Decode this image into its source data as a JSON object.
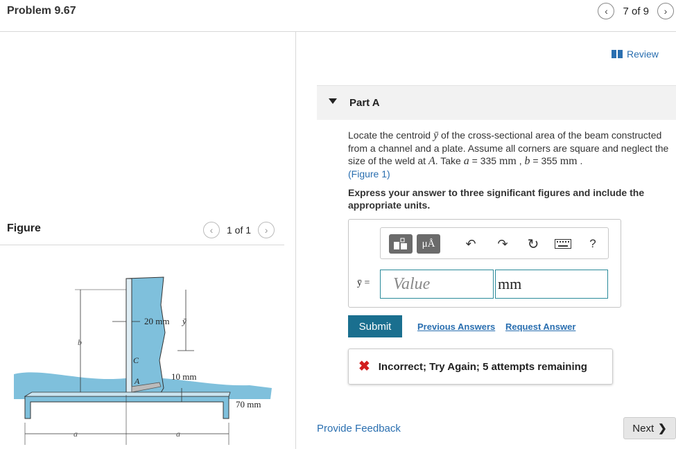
{
  "header": {
    "title": "Problem 9.67",
    "pager": {
      "text": "7 of 9",
      "prev_icon": "chevron-left-icon",
      "next_icon": "chevron-right-icon"
    }
  },
  "figure_panel": {
    "label": "Figure",
    "pager": {
      "text": "1 of 1"
    },
    "figure_labels": {
      "dim_20": "20 mm",
      "ybar": "ȳ",
      "dim_10": "10 mm",
      "dim_70": "70 mm",
      "b": "b",
      "c": "C",
      "a_weld": "A",
      "a_left": "a",
      "a_right": "a"
    }
  },
  "review": {
    "label": "Review",
    "icon": "book-icon"
  },
  "part": {
    "title": "Part A",
    "question_pre": "Locate the centroid ",
    "ybar": "ȳ",
    "question_mid": " of the cross-sectional area of the beam constructed from a channel and a plate. Assume all corners are square and neglect the size of the weld at ",
    "weld_point": "A",
    "question_take": ". Take ",
    "var_a": "a",
    "eq_a": " = 335 ",
    "unit_mm1": "mm",
    "sep": " , ",
    "var_b": "b",
    "eq_b": " = 355 ",
    "unit_mm2": "mm",
    "end": " .",
    "figure_link": "(Figure 1)",
    "instruction": "Express your answer to three significant figures and include the appropriate units."
  },
  "answer": {
    "label": "ȳ =",
    "value_placeholder": "Value",
    "unit_value": "mm",
    "toolbar": {
      "templates_icon": "templates-icon",
      "units_label": "μÅ",
      "undo_icon": "undo-icon",
      "redo_icon": "redo-icon",
      "reset_icon": "reset-icon",
      "keyboard_icon": "keyboard-icon",
      "help_label": "?"
    }
  },
  "actions": {
    "submit": "Submit",
    "previous_answers": "Previous Answers",
    "request_answer": "Request Answer"
  },
  "feedback": {
    "icon": "x-icon",
    "text": "Incorrect; Try Again; 5 attempts remaining"
  },
  "footer": {
    "provide_feedback": "Provide Feedback",
    "next": "Next"
  },
  "colors": {
    "link": "#2a6fb0",
    "submit": "#1a6f8f",
    "error": "#d21f1f",
    "figure_fill": "#7fc0dc"
  }
}
